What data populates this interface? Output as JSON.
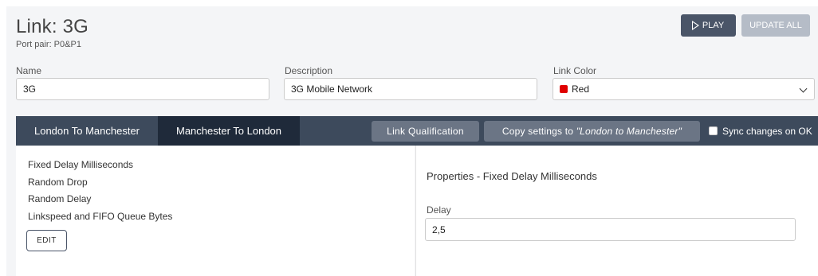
{
  "header": {
    "title": "Link: 3G",
    "subtitle": "Port pair: P0&P1",
    "play_label": "PLAY",
    "update_label": "UPDATE ALL"
  },
  "form": {
    "name_label": "Name",
    "name_value": "3G",
    "description_label": "Description",
    "description_value": "3G Mobile Network",
    "color_label": "Link Color",
    "color_value": "Red",
    "color_hex": "#e00000"
  },
  "tabs": [
    {
      "label": "London To Manchester",
      "active": false
    },
    {
      "label": "Manchester To London",
      "active": true
    }
  ],
  "toolbar": {
    "qualification_label": "Link Qualification",
    "copy_prefix": "Copy settings to ",
    "copy_target": "\"London to Manchester\"",
    "sync_label": "Sync changes on OK",
    "sync_checked": false
  },
  "impairments": {
    "items": [
      "Fixed Delay Milliseconds",
      "Random Drop",
      "Random Delay",
      "Linkspeed and FIFO Queue Bytes"
    ],
    "edit_label": "EDIT"
  },
  "properties": {
    "title": "Properties  - Fixed Delay Milliseconds",
    "delay_label": "Delay",
    "delay_value": "2,5"
  },
  "colors": {
    "tabbar": "#3d4a5c",
    "active_tab": "#1f2a3a",
    "primary_button": "#4a5568",
    "disabled_button": "#b5bcc7"
  }
}
